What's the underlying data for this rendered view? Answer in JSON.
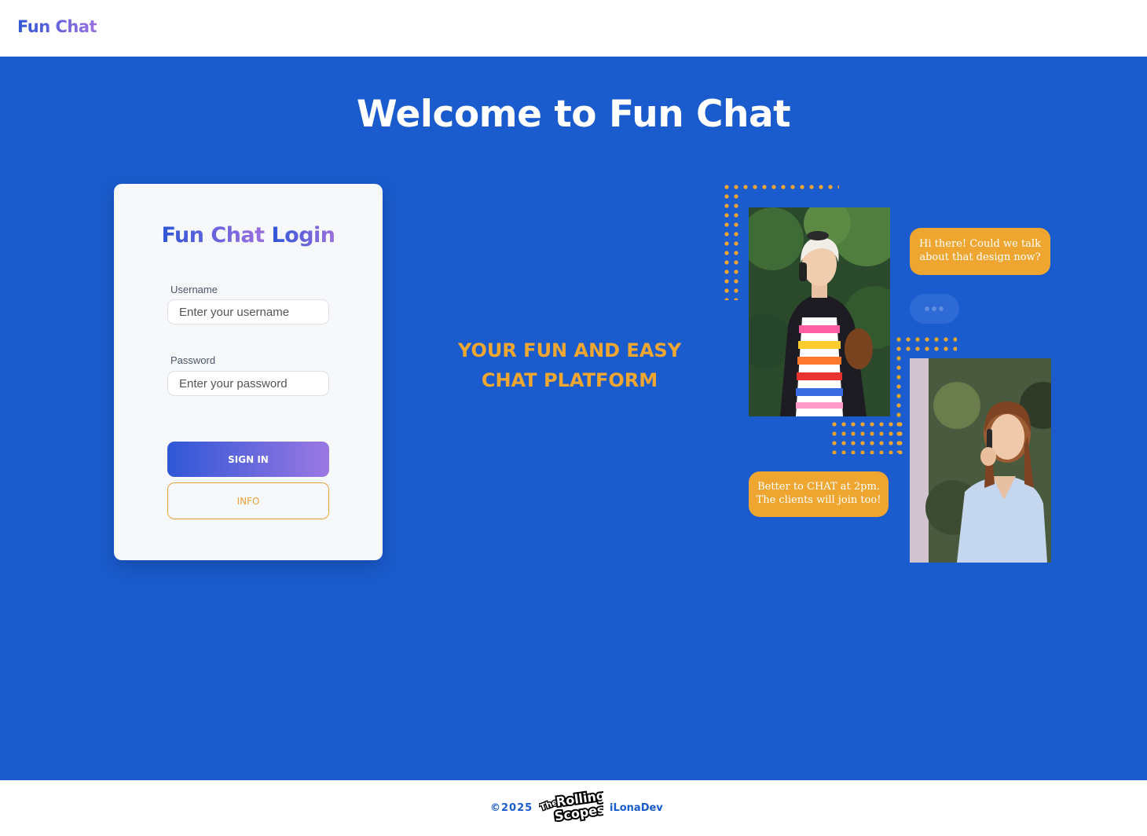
{
  "header": {
    "logo_text": "Fun Chat"
  },
  "main": {
    "welcome_title": "Welcome to Fun Chat",
    "tagline_line1": "YOUR FUN AND EASY",
    "tagline_line2": "CHAT PLATFORM"
  },
  "login": {
    "title_part1": "Fun Chat",
    "title_part2": "Login",
    "username_label": "Username",
    "username_placeholder": "Enter your username",
    "username_value": "",
    "password_label": "Password",
    "password_placeholder": "Enter your password",
    "password_value": "",
    "signin_label": "SIGN IN",
    "info_label": "INFO"
  },
  "illustration": {
    "bubble_top_line1": "Hi there! Could we talk",
    "bubble_top_line2": "about that design now?",
    "bubble_bottom_line1": "Better to CHAT at 2pm.",
    "bubble_bottom_line2": "The clients will join too!"
  },
  "footer": {
    "copyright": "©2025",
    "rs_logo_line1": "The",
    "rs_logo_line2": "Rolling",
    "rs_logo_line3": "Scopes",
    "author": "iLonaDev"
  },
  "colors": {
    "primary_blue": "#1a5bcd",
    "accent_orange": "#efa630",
    "gradient_start": "#2f57d6",
    "gradient_end": "#9b6fe0"
  }
}
